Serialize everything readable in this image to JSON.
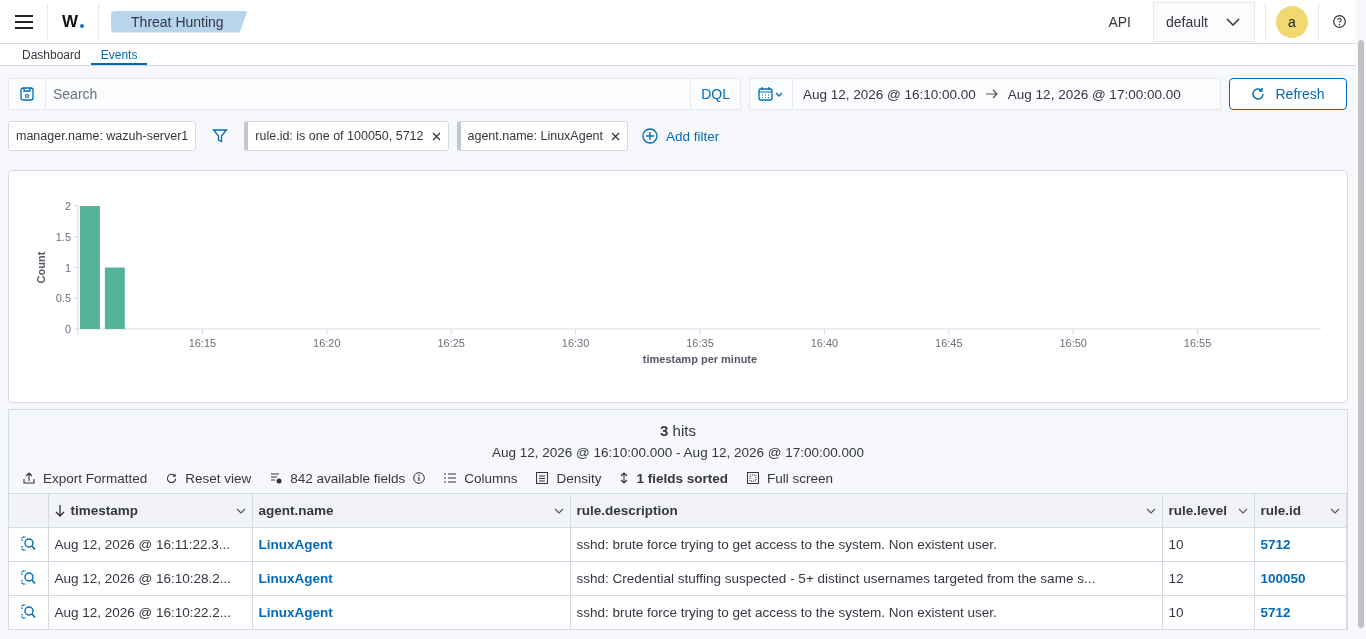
{
  "header": {
    "logo": "W",
    "breadcrumb": "Threat Hunting",
    "api_label": "API",
    "api_select": "default",
    "avatar": "a"
  },
  "tabs": [
    {
      "label": "Dashboard",
      "selected": false
    },
    {
      "label": "Events",
      "selected": true
    }
  ],
  "query_bar": {
    "placeholder": "Search",
    "language": "DQL",
    "start": "Aug 12, 2026 @ 16:10:00.00",
    "end": "Aug 12, 2026 @ 17:00:00.00",
    "refresh": "Refresh"
  },
  "filters": [
    {
      "label": "manager.name: wazuh-server1",
      "removable": false
    },
    {
      "label": "rule.id: is one of 100050, 5712",
      "removable": true
    },
    {
      "label": "agent.name: LinuxAgent",
      "removable": true
    }
  ],
  "add_filter": "Add filter",
  "histogram": {
    "chart_data": {
      "type": "bar",
      "xlabel": "timestamp per minute",
      "ylabel": "Count",
      "ylim": [
        0,
        2
      ],
      "yticks": [
        0,
        0.5,
        1,
        1.5,
        2
      ],
      "categories": [
        null,
        null,
        null,
        null,
        null,
        "16:15",
        null,
        null,
        null,
        null,
        "16:20",
        null,
        null,
        null,
        null,
        "16:25",
        null,
        null,
        null,
        null,
        "16:30",
        null,
        null,
        null,
        null,
        "16:35",
        null,
        null,
        null,
        null,
        "16:40",
        null,
        null,
        null,
        null,
        "16:45",
        null,
        null,
        null,
        null,
        "16:50",
        null,
        null,
        null,
        null,
        "16:55",
        null,
        null,
        null,
        null
      ],
      "values": [
        2,
        1,
        0,
        0,
        0,
        0,
        0,
        0,
        0,
        0,
        0,
        0,
        0,
        0,
        0,
        0,
        0,
        0,
        0,
        0,
        0,
        0,
        0,
        0,
        0,
        0,
        0,
        0,
        0,
        0,
        0,
        0,
        0,
        0,
        0,
        0,
        0,
        0,
        0,
        0,
        0,
        0,
        0,
        0,
        0,
        0,
        0,
        0,
        0,
        0
      ]
    }
  },
  "results": {
    "hits": "**3** hits",
    "range": "Aug 12, 2026 @ 16:10:00.000 - Aug 12, 2026 @ 17:00:00.000",
    "toolbar": [
      {
        "kind": "export",
        "label": "Export Formatted"
      },
      {
        "kind": "reset",
        "label": "Reset view"
      },
      {
        "kind": "fields",
        "label": "842 available fields"
      },
      {
        "kind": "columns",
        "label": "Columns"
      },
      {
        "kind": "density",
        "label": "Density"
      },
      {
        "kind": "sorted",
        "label": "1 fields sorted"
      },
      {
        "kind": "fullscreen",
        "label": "Full screen"
      }
    ],
    "columns": [
      {
        "label": "timestamp",
        "sorted": true
      },
      {
        "label": "agent.name",
        "sorted": false
      },
      {
        "label": "rule.description",
        "sorted": false
      },
      {
        "label": "rule.level",
        "sorted": false
      },
      {
        "label": "rule.id",
        "sorted": false
      }
    ],
    "rows": [
      {
        "timestamp": "Aug 12, 2026 @ 16:11:22.3...",
        "agent": "LinuxAgent",
        "description": "sshd: brute force trying to get access to the system. Non existent user.",
        "level": "10",
        "rule_id": "5712"
      },
      {
        "timestamp": "Aug 12, 2026 @ 16:10:28.2...",
        "agent": "LinuxAgent",
        "description": "sshd: Credential stuffing suspected - 5+ distinct usernames targeted from the same s...",
        "level": "12",
        "rule_id": "100050"
      },
      {
        "timestamp": "Aug 12, 2026 @ 16:10:22.2...",
        "agent": "LinuxAgent",
        "description": "sshd: brute force trying to get access to the system. Non existent user.",
        "level": "10",
        "rule_id": "5712"
      }
    ]
  }
}
